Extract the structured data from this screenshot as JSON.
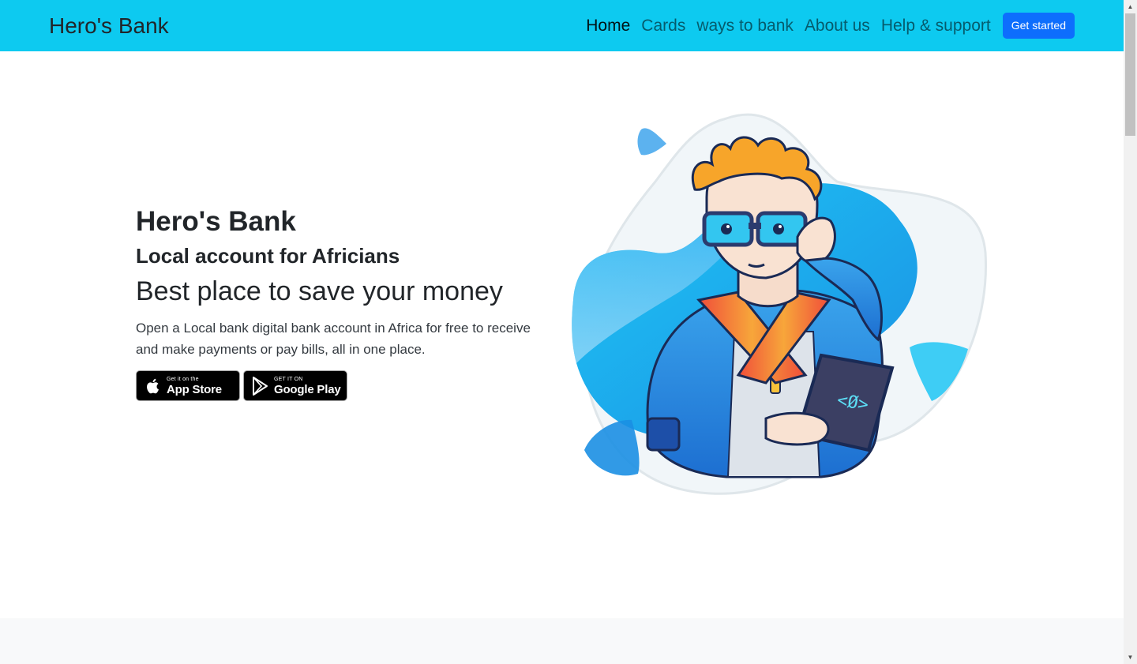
{
  "navbar": {
    "brand": "Hero's Bank",
    "links": [
      "Home",
      "Cards",
      "ways to bank",
      "About us",
      "Help & support"
    ],
    "cta": "Get started"
  },
  "hero": {
    "title": "Hero's Bank",
    "subtitle": "Local account for Africians",
    "tagline": "Best place to save your money",
    "description": "Open a Local bank digital bank account in Africa for free to receive and make payments or pay bills, all in one place.",
    "app_store": {
      "small": "Get it on the",
      "big": "App Store"
    },
    "google_play": {
      "small": "GET IT ON",
      "big": "Google Play"
    }
  },
  "colors": {
    "navbar": "#0dcaf0",
    "button": "#0d6efd",
    "illustration_blue": "#1ea1f2"
  },
  "icons": [
    "apple-icon",
    "google-play-icon",
    "scroll-up-icon",
    "scroll-down-icon"
  ]
}
